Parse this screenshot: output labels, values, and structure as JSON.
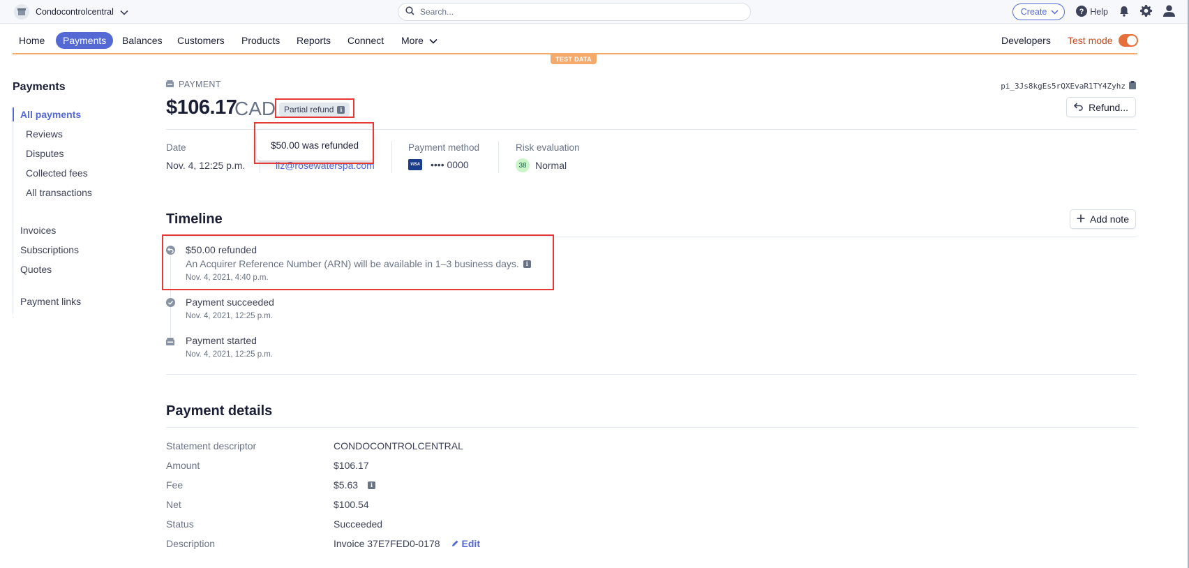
{
  "topbar": {
    "account_name": "Condocontrolcentral",
    "search_placeholder": "Search...",
    "create_label": "Create",
    "help_label": "Help"
  },
  "nav": {
    "items": [
      "Home",
      "Payments",
      "Balances",
      "Customers",
      "Products",
      "Reports",
      "Connect",
      "More"
    ],
    "active": "Payments",
    "developers": "Developers",
    "test_mode": "Test mode",
    "test_mode_on": true,
    "test_data_banner": "TEST DATA"
  },
  "sidebar": {
    "title": "Payments",
    "all_payments": "All payments",
    "sub_items": [
      "Reviews",
      "Disputes",
      "Collected fees",
      "All transactions"
    ],
    "groups": [
      "Invoices",
      "Subscriptions",
      "Quotes"
    ],
    "payment_links": "Payment links"
  },
  "payment": {
    "label": "PAYMENT",
    "id": "pi_3Js8kgEs5rQXEvaR1TY4Zyhz",
    "amount": "$106.17",
    "currency": "CAD",
    "status_badge": "Partial refund",
    "refund_button": "Refund...",
    "tooltip": "$50.00 was refunded"
  },
  "meta": {
    "date_label": "Date",
    "date_value": "Nov. 4, 12:25 p.m.",
    "customer_email": "liz@rosewaterspa.com",
    "method_label": "Payment method",
    "card_brand": "VISA",
    "card_last4": "•••• 0000",
    "risk_label": "Risk evaluation",
    "risk_score": "38",
    "risk_level": "Normal"
  },
  "timeline": {
    "title": "Timeline",
    "add_note": "Add note",
    "events": [
      {
        "title": "$50.00 refunded",
        "subtitle": "An Acquirer Reference Number (ARN) will be available in 1–3 business days.",
        "time": "Nov. 4, 2021, 4:40 p.m."
      },
      {
        "title": "Payment succeeded",
        "time": "Nov. 4, 2021, 12:25 p.m."
      },
      {
        "title": "Payment started",
        "time": "Nov. 4, 2021, 12:25 p.m."
      }
    ]
  },
  "details": {
    "title": "Payment details",
    "rows": [
      {
        "label": "Statement descriptor",
        "value": "CONDOCONTROLCENTRAL"
      },
      {
        "label": "Amount",
        "value": "$106.17"
      },
      {
        "label": "Fee",
        "value": "$5.63"
      },
      {
        "label": "Net",
        "value": "$100.54"
      },
      {
        "label": "Status",
        "value": "Succeeded"
      },
      {
        "label": "Description",
        "value": "Invoice 37E7FED0-0178"
      }
    ],
    "edit_label": "Edit"
  },
  "colors": {
    "accent": "#5469d4",
    "test_mode": "#e56f3a",
    "highlight": "#e53935"
  }
}
